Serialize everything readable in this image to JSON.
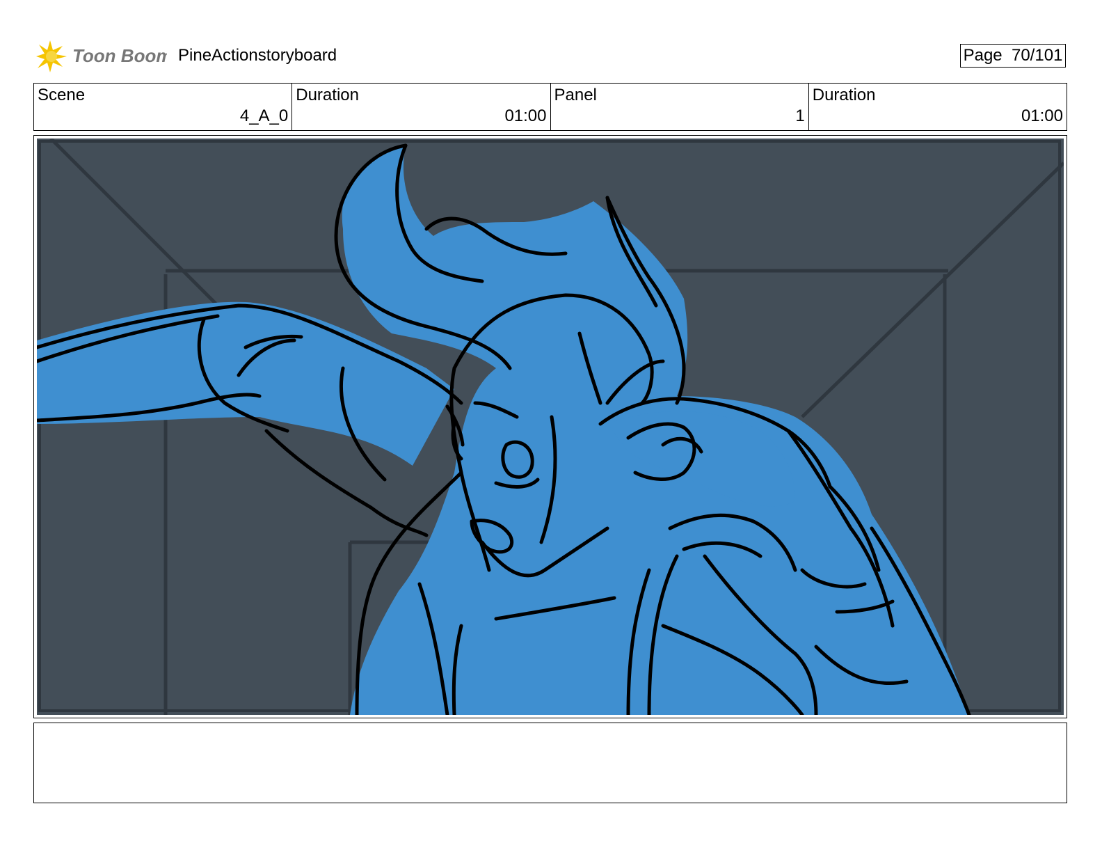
{
  "header": {
    "logo_text": "Toon Boom",
    "project_title": "PineActionstoryboard",
    "page_label": "Page  70/101"
  },
  "info": {
    "scene_label": "Scene",
    "scene_value": "4_A_0",
    "scene_duration_label": "Duration",
    "scene_duration_value": "01:00",
    "panel_label": "Panel",
    "panel_value": "1",
    "panel_duration_label": "Duration",
    "panel_duration_value": "01:00"
  },
  "panel": {
    "background_color": "#434e58",
    "fill_color": "#3f8fd0",
    "line_color": "#000000"
  },
  "notes": {
    "text": ""
  }
}
